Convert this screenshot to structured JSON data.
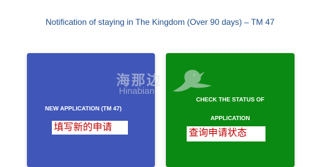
{
  "page": {
    "title": "Notification of staying in The Kingdom (Over 90 days) – TM 47"
  },
  "cards": {
    "new_application": {
      "label": "NEW APPLICATION (TM 47)",
      "annotation": "填写新的申请",
      "color": "#4056b8"
    },
    "check_status": {
      "label_line1": "CHECK THE STATUS OF",
      "label_line2": "APPLICATION",
      "annotation": "查询申请状态",
      "color": "#0a8a12"
    }
  },
  "watermark": {
    "text_cn": "海那边",
    "text_en": "Hinabian",
    "icon": "bird-logo-icon"
  },
  "colors": {
    "title": "#1f4e8c",
    "annotation_text": "#c00000"
  }
}
